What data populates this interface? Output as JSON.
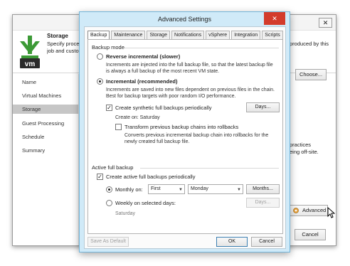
{
  "wizard": {
    "close_glyph": "✕",
    "header": {
      "title": "Storage",
      "desc_left_line1": "Specify proces",
      "desc_left_line2": "job and custor",
      "desc_right_line1": "produced by this"
    },
    "sidebar": {
      "items": [
        {
          "label": "Name"
        },
        {
          "label": "Virtual Machines"
        },
        {
          "label": "Storage"
        },
        {
          "label": "Guest Processing"
        },
        {
          "label": "Schedule"
        },
        {
          "label": "Summary"
        }
      ],
      "selected_index": 2
    },
    "choose_label": "Choose...",
    "note_line1": "practices",
    "note_line2": "eing off-site.",
    "advanced_label": "Advanced",
    "cancel_label": "Cancel"
  },
  "dialog": {
    "title": "Advanced Settings",
    "close_glyph": "✕",
    "tabs": [
      {
        "label": "Backup",
        "active": true
      },
      {
        "label": "Maintenance"
      },
      {
        "label": "Storage"
      },
      {
        "label": "Notifications"
      },
      {
        "label": "vSphere"
      },
      {
        "label": "Integration"
      },
      {
        "label": "Scripts"
      }
    ],
    "backup_mode": {
      "section_label": "Backup mode",
      "reverse": {
        "label": "Reverse incremental (slower)",
        "selected": false,
        "desc_line1": "Increments are injected into the full backup file, so that the latest backup file",
        "desc_line2": "is always a full backup of the most recent VM state."
      },
      "incremental": {
        "label": "Incremental (recommended)",
        "selected": true,
        "desc_line1": "Increments are saved into new files dependent on previous files in the chain.",
        "desc_line2": "Best for backup targets with poor random I/O performance."
      },
      "synthetic": {
        "label": "Create synthetic full backups periodically",
        "checked": true,
        "days_button": "Days...",
        "create_on": "Create on:   Saturday"
      },
      "transform": {
        "label": "Transform previous backup chains into rollbacks",
        "checked": false,
        "desc_line1": "Converts previous incremental backup chain into rollbacks for the",
        "desc_line2": "newly created full backup file."
      }
    },
    "active_full": {
      "section_label": "Active full backup",
      "create": {
        "label": "Create active full backups periodically",
        "checked": true
      },
      "monthly": {
        "label": "Monthly on:",
        "selected": true,
        "week_value": "First",
        "day_value": "Monday",
        "months_button": "Months..."
      },
      "weekly": {
        "label": "Weekly on selected days:",
        "selected": false,
        "days_button": "Days...",
        "day_text": "Saturday"
      }
    },
    "footer": {
      "save_default": "Save As Default",
      "ok": "OK",
      "cancel": "Cancel"
    }
  },
  "colors": {
    "dialog_frame": "#d0eaf8",
    "close_red": "#d33b2b",
    "vm_green": "#3c9a36"
  }
}
